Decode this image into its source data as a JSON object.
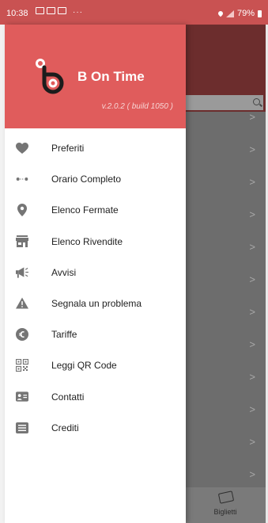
{
  "status_bar": {
    "time": "10:38",
    "overflow": "···",
    "battery": "79%"
  },
  "drawer": {
    "app_name": "B On Time",
    "version": "v.2.0.2 ( build 1050 )",
    "items": [
      {
        "label": "Preferiti",
        "icon": "heart-icon"
      },
      {
        "label": "Orario Completo",
        "icon": "route-dots-icon"
      },
      {
        "label": "Elenco Fermate",
        "icon": "location-pin-icon"
      },
      {
        "label": "Elenco Rivendite",
        "icon": "store-icon"
      },
      {
        "label": "Avvisi",
        "icon": "megaphone-icon"
      },
      {
        "label": "Segnala un problema",
        "icon": "warning-icon"
      },
      {
        "label": "Tariffe",
        "icon": "euro-coin-icon"
      },
      {
        "label": "Leggi QR Code",
        "icon": "qr-code-icon"
      },
      {
        "label": "Contatti",
        "icon": "contact-card-icon"
      },
      {
        "label": "Crediti",
        "icon": "credits-list-icon"
      }
    ]
  },
  "background_screen": {
    "bottom_tab_label": "Biglietti",
    "row_chevron": ">"
  },
  "colors": {
    "header": "#e05c5c",
    "status_bar": "#c95252",
    "icon": "#757575"
  }
}
